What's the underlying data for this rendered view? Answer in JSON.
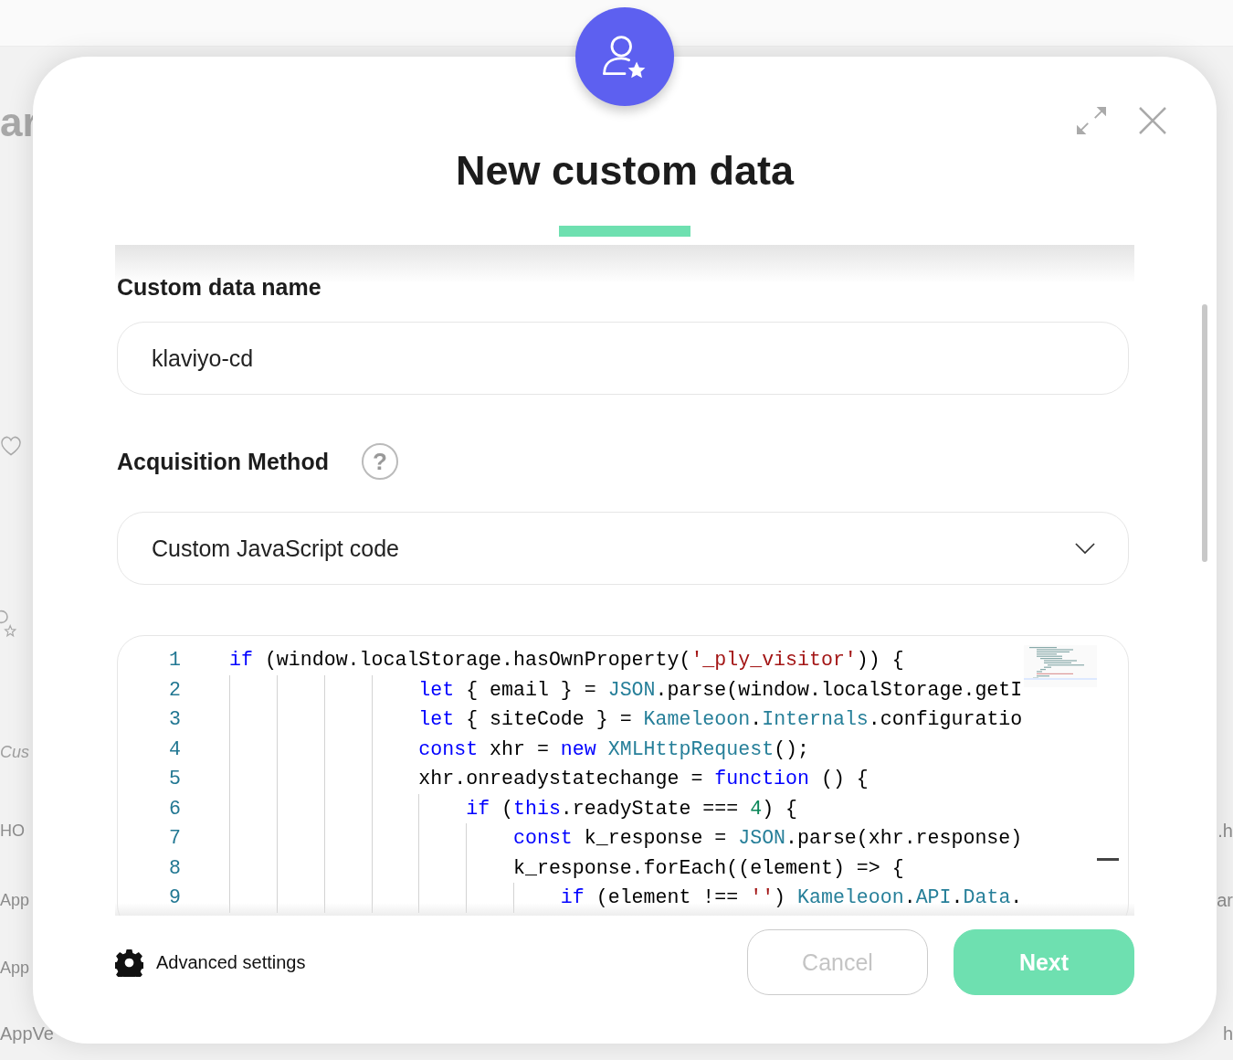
{
  "background": {
    "left_fragments": [
      "ar",
      "Cus",
      "HO",
      "App",
      "App",
      "AppVe"
    ],
    "right_fragments": [
      ".h",
      "ar",
      "h"
    ]
  },
  "dialog": {
    "title": "New custom data",
    "name_field": {
      "label": "Custom data name",
      "value": "klaviyo-cd"
    },
    "method_field": {
      "label": "Acquisition Method",
      "help": "?",
      "value": "Custom JavaScript code"
    },
    "code_lines": [
      {
        "number": "1",
        "tokens": [
          {
            "kind": "keyword",
            "text": "if"
          },
          {
            "kind": "plain",
            "text": " (window.localStorage.hasOwnProperty("
          },
          {
            "kind": "string",
            "text": "'_ply_visitor'"
          },
          {
            "kind": "plain",
            "text": ")) {"
          }
        ]
      },
      {
        "number": "2",
        "tokens": [
          {
            "kind": "keyword",
            "text": "                let"
          },
          {
            "kind": "plain",
            "text": " { email } = "
          },
          {
            "kind": "type",
            "text": "JSON"
          },
          {
            "kind": "plain",
            "text": ".parse(window.localStorage.getI"
          }
        ]
      },
      {
        "number": "3",
        "tokens": [
          {
            "kind": "keyword",
            "text": "                let"
          },
          {
            "kind": "plain",
            "text": " { siteCode } = "
          },
          {
            "kind": "type",
            "text": "Kameleoon"
          },
          {
            "kind": "plain",
            "text": "."
          },
          {
            "kind": "type",
            "text": "Internals"
          },
          {
            "kind": "plain",
            "text": ".configuratio"
          }
        ]
      },
      {
        "number": "4",
        "tokens": [
          {
            "kind": "keyword",
            "text": "                const"
          },
          {
            "kind": "plain",
            "text": " xhr = "
          },
          {
            "kind": "keyword",
            "text": "new"
          },
          {
            "kind": "type",
            "text": " XMLHttpRequest"
          },
          {
            "kind": "plain",
            "text": "();"
          }
        ]
      },
      {
        "number": "5",
        "tokens": [
          {
            "kind": "plain",
            "text": "                xhr.onreadystatechange = "
          },
          {
            "kind": "keyword",
            "text": "function"
          },
          {
            "kind": "plain",
            "text": " () {"
          }
        ]
      },
      {
        "number": "6",
        "tokens": [
          {
            "kind": "keyword",
            "text": "                    if"
          },
          {
            "kind": "plain",
            "text": " ("
          },
          {
            "kind": "keyword",
            "text": "this"
          },
          {
            "kind": "plain",
            "text": ".readyState === "
          },
          {
            "kind": "number",
            "text": "4"
          },
          {
            "kind": "plain",
            "text": ") {"
          }
        ]
      },
      {
        "number": "7",
        "tokens": [
          {
            "kind": "keyword",
            "text": "                        const"
          },
          {
            "kind": "plain",
            "text": " k_response = "
          },
          {
            "kind": "type",
            "text": "JSON"
          },
          {
            "kind": "plain",
            "text": ".parse(xhr.response)"
          }
        ]
      },
      {
        "number": "8",
        "tokens": [
          {
            "kind": "plain",
            "text": "                        k_response.forEach((element) => {"
          }
        ]
      },
      {
        "number": "9",
        "tokens": [
          {
            "kind": "keyword",
            "text": "                            if"
          },
          {
            "kind": "plain",
            "text": " (element !== "
          },
          {
            "kind": "string",
            "text": "''"
          },
          {
            "kind": "plain",
            "text": ") "
          },
          {
            "kind": "type",
            "text": "Kameleoon"
          },
          {
            "kind": "plain",
            "text": "."
          },
          {
            "kind": "type",
            "text": "API"
          },
          {
            "kind": "plain",
            "text": "."
          },
          {
            "kind": "type",
            "text": "Data"
          },
          {
            "kind": "plain",
            "text": "."
          }
        ]
      }
    ],
    "advanced_settings": "Advanced settings",
    "buttons": [
      {
        "kind": "secondary",
        "label": "Cancel",
        "disabled": true
      },
      {
        "kind": "primary",
        "label": "Next",
        "disabled": false
      }
    ]
  }
}
